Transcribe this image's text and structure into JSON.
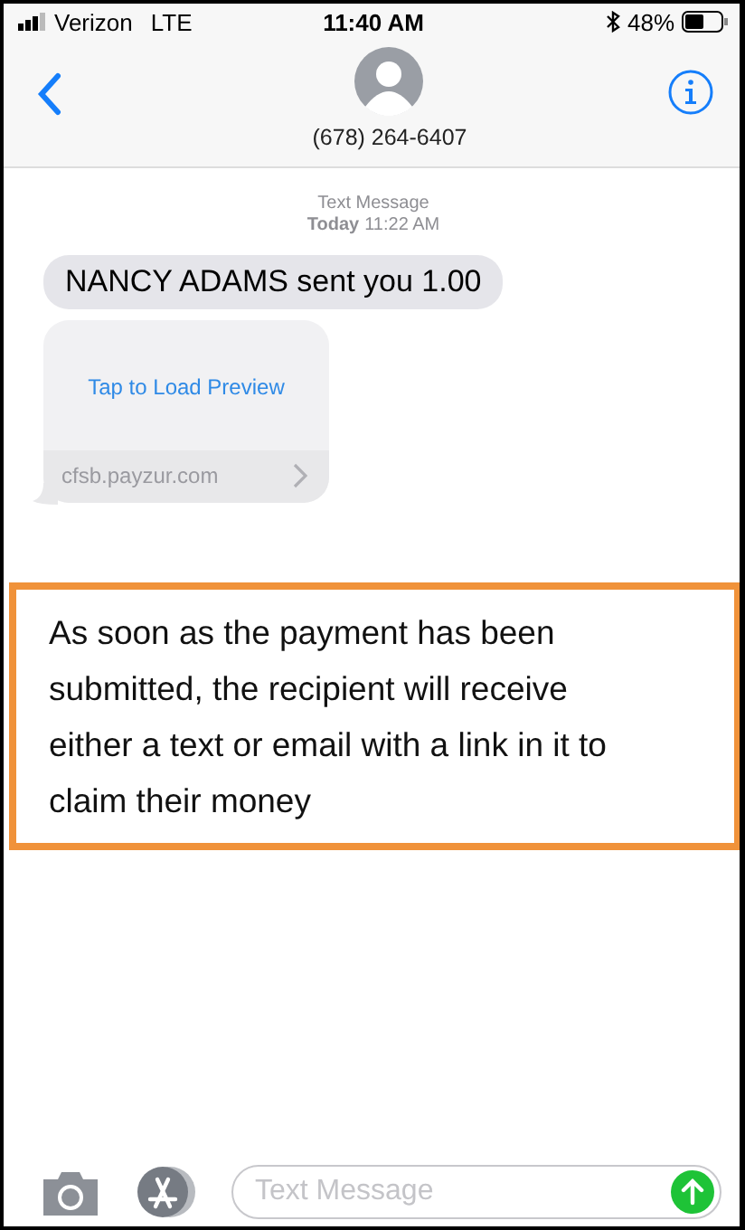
{
  "status_bar": {
    "carrier": "Verizon",
    "network": "LTE",
    "time": "11:40 AM",
    "battery": "48%"
  },
  "header": {
    "contact": "(678) 264-6407"
  },
  "thread": {
    "service": "Text Message",
    "day": "Today",
    "time": "11:22 AM",
    "messages": [
      {
        "kind": "text",
        "text": "NANCY ADAMS sent you 1.00"
      },
      {
        "kind": "link_preview",
        "action": "Tap to Load Preview",
        "domain": "cfsb.payzur.com"
      }
    ]
  },
  "annotation": {
    "text": "As soon as the payment has been submitted, the recipient will receive either a text or email with a link in it to claim their money"
  },
  "composer": {
    "placeholder": "Text Message"
  }
}
